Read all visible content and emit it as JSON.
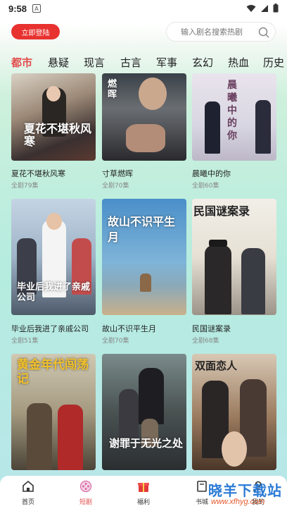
{
  "status_bar": {
    "time": "9:58"
  },
  "header": {
    "login_label": "立即登陆",
    "search_placeholder": "输入剧名搜索热剧"
  },
  "tabs": [
    "都市",
    "悬疑",
    "现言",
    "古言",
    "军事",
    "玄幻",
    "热血",
    "历史"
  ],
  "cards": [
    {
      "title": "夏花不堪秋风寒",
      "eps": "全剧79集",
      "poster_text": "夏花不堪秋风寒"
    },
    {
      "title": "寸草燃晖",
      "eps": "全剧70集",
      "poster_text": "燃晖"
    },
    {
      "title": "晨曦中的你",
      "eps": "全剧60集",
      "poster_text": "晨曦中的你"
    },
    {
      "title": "毕业后我进了亲戚公司",
      "eps": "全剧51集",
      "poster_text": "毕业后我进了亲戚公司"
    },
    {
      "title": "故山不识平生月",
      "eps": "全剧70集",
      "poster_text": "故山不识平生月"
    },
    {
      "title": "民国谜案录",
      "eps": "全剧68集",
      "poster_text": "民国谜案录"
    },
    {
      "title": "",
      "eps": "",
      "poster_text": "黄金年代闯荡记"
    },
    {
      "title": "",
      "eps": "",
      "poster_text": "谢罪于无光之处"
    },
    {
      "title": "",
      "eps": "",
      "poster_text": "双面恋人"
    }
  ],
  "bottom_nav": [
    {
      "label": "首页",
      "icon": "home-icon"
    },
    {
      "label": "短剧",
      "icon": "film-reel-icon"
    },
    {
      "label": "福利",
      "icon": "gift-icon"
    },
    {
      "label": "书城",
      "icon": "book-icon"
    },
    {
      "label": "我的",
      "icon": "user-icon"
    }
  ],
  "watermark": {
    "main": "晓羊下载站",
    "url": "www.xfhyg.com"
  },
  "colors": {
    "accent": "#e24c4c",
    "login_bg": "#e8322f"
  }
}
